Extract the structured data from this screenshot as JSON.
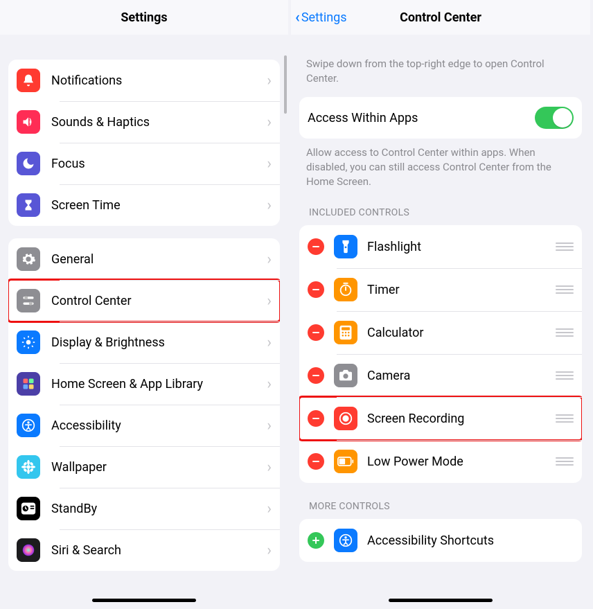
{
  "left": {
    "title": "Settings",
    "groups": [
      {
        "rows": [
          {
            "label": "Notifications",
            "icon": "bell",
            "bg": "#ff3b30"
          },
          {
            "label": "Sounds & Haptics",
            "icon": "speaker",
            "bg": "#ff2d55"
          },
          {
            "label": "Focus",
            "icon": "moon",
            "bg": "#5856d6"
          },
          {
            "label": "Screen Time",
            "icon": "hourglass",
            "bg": "#5856d6"
          }
        ]
      },
      {
        "rows": [
          {
            "label": "General",
            "icon": "gear",
            "bg": "#8e8e93"
          },
          {
            "label": "Control Center",
            "icon": "sliders",
            "bg": "#8e8e93",
            "highlight": true
          },
          {
            "label": "Display & Brightness",
            "icon": "brightness",
            "bg": "#0a7aff"
          },
          {
            "label": "Home Screen & App Library",
            "icon": "grid",
            "bg": "#4b3fa7"
          },
          {
            "label": "Accessibility",
            "icon": "figure",
            "bg": "#0a7aff"
          },
          {
            "label": "Wallpaper",
            "icon": "flower",
            "bg": "#33c6ee"
          },
          {
            "label": "StandBy",
            "icon": "clock-card",
            "bg": "#000000"
          },
          {
            "label": "Siri & Search",
            "icon": "siri",
            "bg": "#1c1c1e"
          }
        ]
      }
    ]
  },
  "right": {
    "back_label": "Settings",
    "title": "Control Center",
    "intro": "Swipe down from the top-right edge to open Control Center.",
    "access_row": {
      "label": "Access Within Apps",
      "on": true
    },
    "access_footer": "Allow access to Control Center within apps. When disabled, you can still access Control Center from the Home Screen.",
    "included_header": "INCLUDED CONTROLS",
    "included": [
      {
        "label": "Flashlight",
        "icon": "flashlight",
        "bg": "#0a7aff"
      },
      {
        "label": "Timer",
        "icon": "timer",
        "bg": "#ff9500"
      },
      {
        "label": "Calculator",
        "icon": "calc",
        "bg": "#ff9500"
      },
      {
        "label": "Camera",
        "icon": "camera",
        "bg": "#8e8e93"
      },
      {
        "label": "Screen Recording",
        "icon": "record",
        "bg": "#ff3b30",
        "highlight": true
      },
      {
        "label": "Low Power Mode",
        "icon": "battery",
        "bg": "#ff9500"
      }
    ],
    "more_header": "MORE CONTROLS",
    "more": [
      {
        "label": "Accessibility Shortcuts",
        "icon": "figure",
        "bg": "#0a7aff"
      }
    ]
  }
}
